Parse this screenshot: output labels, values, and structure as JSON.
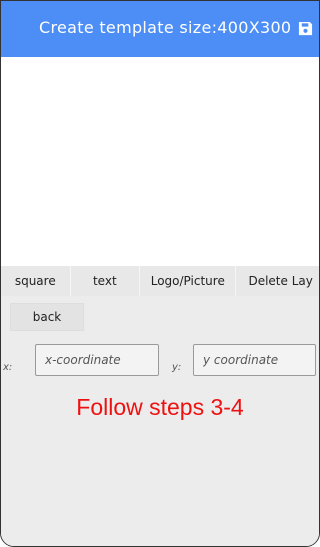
{
  "appbar": {
    "title": "Create template size:400X300",
    "save_icon": "save-icon",
    "background": "#4c8ef5"
  },
  "toolbar": {
    "items": [
      {
        "label": "square"
      },
      {
        "label": "text"
      },
      {
        "label": "Logo/Picture"
      },
      {
        "label": "Delete Lay"
      }
    ]
  },
  "panel": {
    "back_label": "back",
    "x_label": "x:",
    "x_placeholder": "x-coordinate",
    "y_label": "y:",
    "y_placeholder": "y coordinate"
  },
  "instruction": {
    "text": "Follow steps 3-4",
    "color": "#ee1111"
  }
}
